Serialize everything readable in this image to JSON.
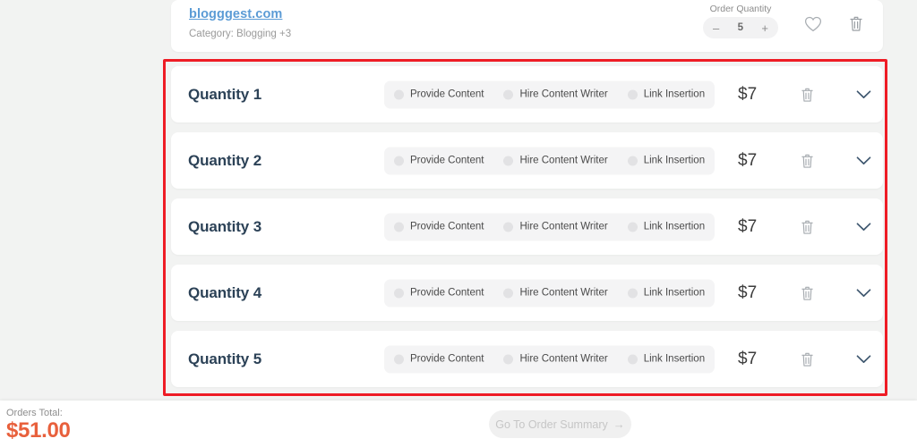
{
  "site_card": {
    "link_text": "blogggest.com",
    "category_text": "Category: Blogging +3",
    "order_quantity_label": "Order Quantity",
    "minus_label": "–",
    "quantity_value": "5",
    "plus_label": "+",
    "wishlist_icon": "heart-icon",
    "delete_icon": "trash-icon"
  },
  "quantity_rows": [
    {
      "title": "Quantity 1",
      "options": [
        "Provide Content",
        "Hire Content Writer",
        "Link Insertion"
      ],
      "price": "$7",
      "delete_icon": "trash-icon",
      "expand_icon": "chevron-down-icon"
    },
    {
      "title": "Quantity 2",
      "options": [
        "Provide Content",
        "Hire Content Writer",
        "Link Insertion"
      ],
      "price": "$7",
      "delete_icon": "trash-icon",
      "expand_icon": "chevron-down-icon"
    },
    {
      "title": "Quantity 3",
      "options": [
        "Provide Content",
        "Hire Content Writer",
        "Link Insertion"
      ],
      "price": "$7",
      "delete_icon": "trash-icon",
      "expand_icon": "chevron-down-icon"
    },
    {
      "title": "Quantity 4",
      "options": [
        "Provide Content",
        "Hire Content Writer",
        "Link Insertion"
      ],
      "price": "$7",
      "delete_icon": "trash-icon",
      "expand_icon": "chevron-down-icon"
    },
    {
      "title": "Quantity 5",
      "options": [
        "Provide Content",
        "Hire Content Writer",
        "Link Insertion"
      ],
      "price": "$7",
      "delete_icon": "trash-icon",
      "expand_icon": "chevron-down-icon"
    }
  ],
  "footer": {
    "total_label": "Orders Total:",
    "total_value": "$51.00",
    "cta_label": "Go To Order Summary",
    "cta_arrow": "→"
  },
  "annotation": {
    "highlight_color": "#ee1c25"
  },
  "colors": {
    "page_background": "#f2f3f2",
    "card_background": "#ffffff",
    "title_text": "#2c4257",
    "link": "#5b9bd5",
    "total_accent": "#e8603c",
    "segment_background": "#f4f4f5"
  }
}
